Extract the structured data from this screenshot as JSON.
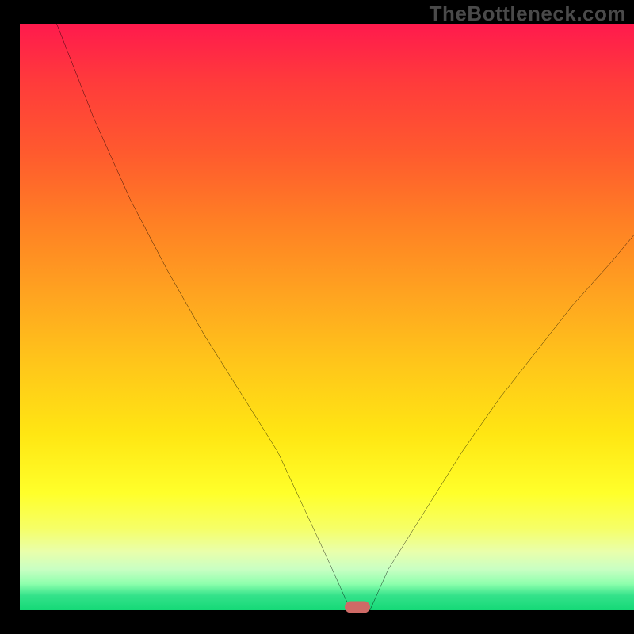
{
  "watermark": "TheBottleneck.com",
  "chart_data": {
    "type": "line",
    "title": "",
    "xlabel": "",
    "ylabel": "",
    "xlim": [
      0,
      100
    ],
    "ylim": [
      0,
      100
    ],
    "x": [
      0,
      6,
      12,
      18,
      24,
      30,
      36,
      42,
      46,
      50,
      53,
      54,
      57,
      60,
      66,
      72,
      78,
      84,
      90,
      96,
      100
    ],
    "values": [
      118,
      100,
      84,
      70,
      58,
      47,
      37,
      27,
      18,
      9,
      2,
      0,
      0,
      7,
      17,
      27,
      36,
      44,
      52,
      59,
      64
    ],
    "background_gradient": {
      "top": "#ff1a4d",
      "mid": "#ffe613",
      "bottom": "#15d977"
    },
    "marker": {
      "x": 55,
      "y": 0.5,
      "color": "#cf6a66"
    }
  }
}
